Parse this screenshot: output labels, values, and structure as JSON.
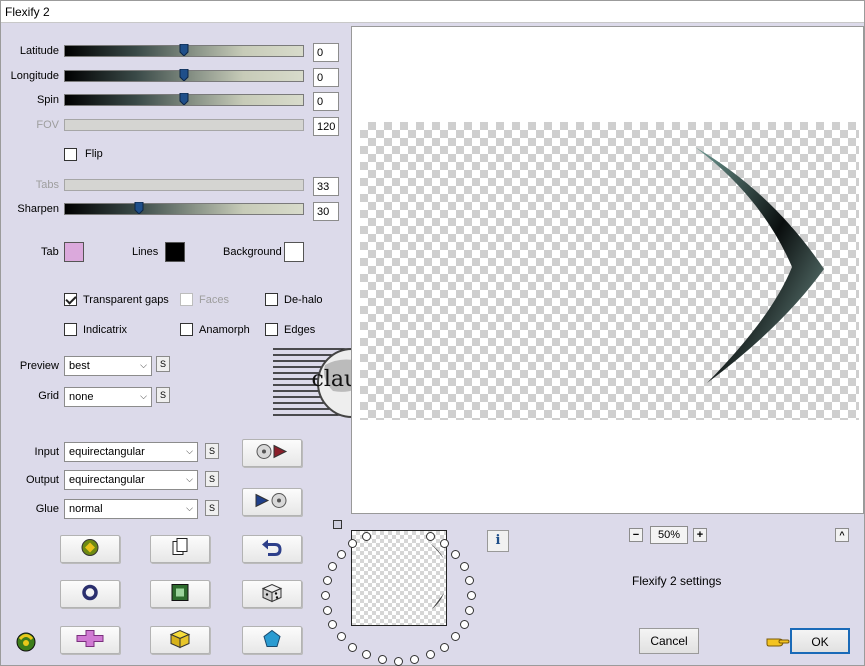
{
  "window": {
    "title": "Flexify 2"
  },
  "sliders": [
    {
      "label": "Latitude",
      "value": "0",
      "enabled": true,
      "level": 0.5
    },
    {
      "label": "Longitude",
      "value": "0",
      "enabled": true,
      "level": 0.5
    },
    {
      "label": "Spin",
      "value": "0",
      "enabled": true,
      "level": 0.5
    },
    {
      "label": "FOV",
      "value": "120",
      "enabled": false,
      "level": 0.0
    },
    {
      "label": "Tabs",
      "value": "33",
      "enabled": false,
      "level": 0.0
    },
    {
      "label": "Sharpen",
      "value": "30",
      "enabled": true,
      "level": 0.3
    }
  ],
  "flip": {
    "label": "Flip",
    "checked": false
  },
  "colors": {
    "tab": {
      "label": "Tab",
      "color": "#dba9dc"
    },
    "lines": {
      "label": "Lines",
      "color": "#000000"
    },
    "background": {
      "label": "Background",
      "color": "#ffffff"
    }
  },
  "options": {
    "transparent_gaps": {
      "label": "Transparent gaps",
      "checked": true
    },
    "faces": {
      "label": "Faces",
      "checked": false,
      "enabled": false
    },
    "dehalo": {
      "label": "De-halo",
      "checked": false
    },
    "indicatrix": {
      "label": "Indicatrix",
      "checked": false
    },
    "anamorph": {
      "label": "Anamorph",
      "checked": false
    },
    "edges": {
      "label": "Edges",
      "checked": false
    }
  },
  "selects": {
    "preview": {
      "label": "Preview",
      "value": "best"
    },
    "grid": {
      "label": "Grid",
      "value": "none"
    },
    "input": {
      "label": "Input",
      "value": "equirectangular"
    },
    "output": {
      "label": "Output",
      "value": "equirectangular"
    },
    "glue": {
      "label": "Glue",
      "value": "normal"
    }
  },
  "s_button": "S",
  "watermark": {
    "text": "claudia"
  },
  "zoom": {
    "value": "50%",
    "minus": "−",
    "plus": "+",
    "collapse": "^"
  },
  "settings_name": "Flexify 2 settings",
  "info_icon": "i",
  "buttons": {
    "cancel": "Cancel",
    "ok": "OK"
  },
  "icons": [
    "randomize-icon",
    "copy-icon",
    "undo-icon",
    "circle-icon",
    "square-icon",
    "dice-icon",
    "logo-icon",
    "cross-icon",
    "cube-icon",
    "pentagon-icon"
  ],
  "accent": "#1f4f8a"
}
